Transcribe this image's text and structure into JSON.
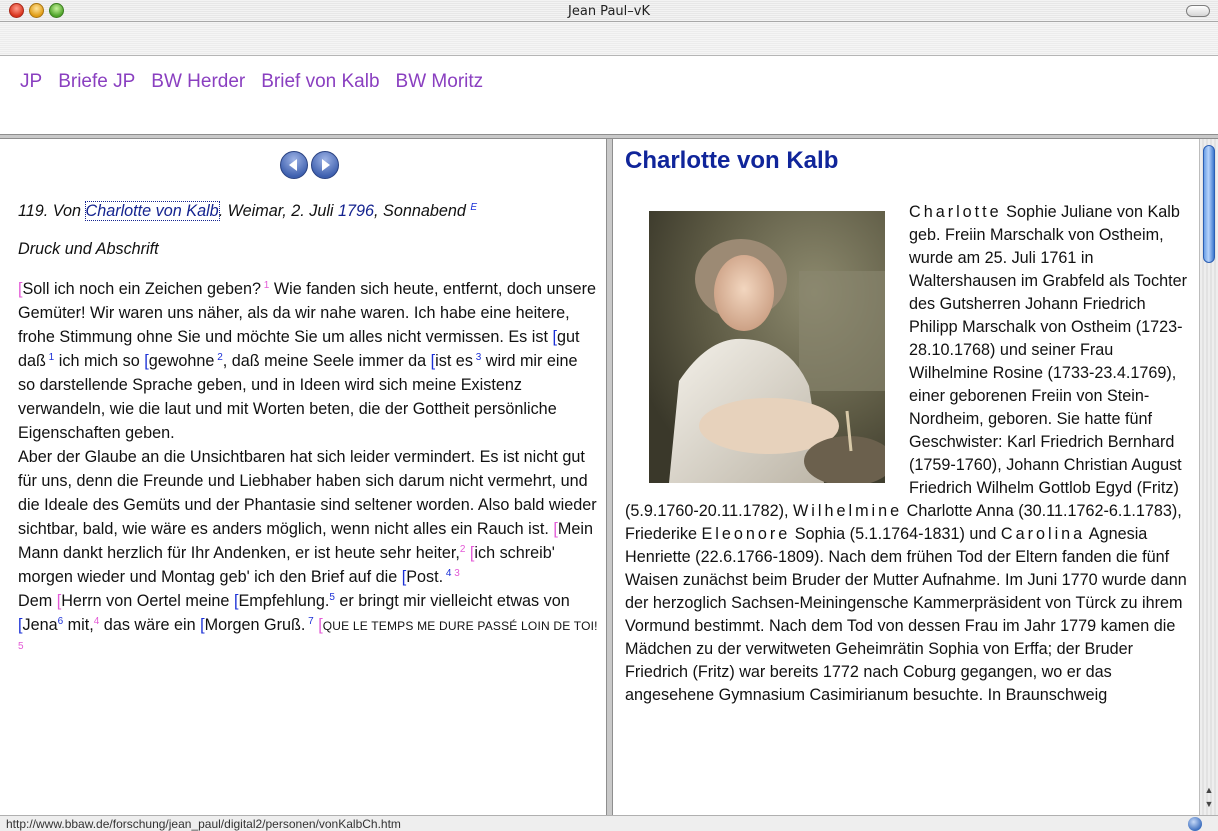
{
  "window": {
    "title": "Jean Paul–vK"
  },
  "nav": {
    "items": [
      "JP",
      "Briefe JP",
      "BW Herder",
      "Brief von Kalb",
      "BW Moritz"
    ]
  },
  "letter": {
    "number_prefix": "119. Von ",
    "person": "Charlotte von Kalb",
    "place_date": ". Weimar, 2. Juli ",
    "year": "1796",
    "weekday": ", Sonnabend ",
    "heading_sup": "E",
    "source": "Druck und Abschrift"
  },
  "right": {
    "title": "Charlotte von Kalb",
    "portrait_alt": "portrait-image"
  },
  "status": {
    "url": "http://www.bbaw.de/forschung/jean_paul/digital2/personen/vonKalbCh.htm"
  },
  "colors": {
    "nav_link": "#8a3fc0",
    "heading_blue": "#10259a",
    "footnote_pink": "#e35ad6",
    "footnote_blue": "#1a2fd6"
  }
}
